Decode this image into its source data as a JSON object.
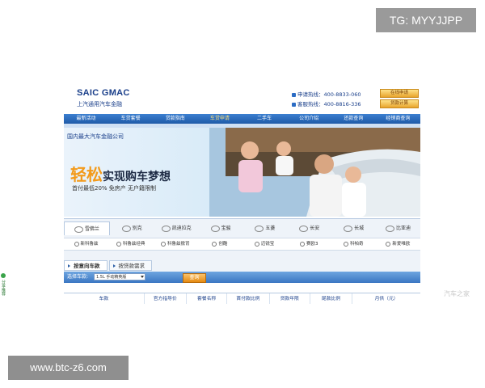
{
  "watermark_top": "TG: MYYJJPP",
  "watermark_bottom": "www.btc-z6.com",
  "header": {
    "logo_en": "SAIC GMAC",
    "logo_cn": "上汽通用汽车金融",
    "hotline_apply_label": "申请热线：",
    "hotline_apply_number": "400-8833-060",
    "hotline_service_label": "客服热线：",
    "hotline_service_number": "400-8816-336",
    "btn_online_apply": "在线申请",
    "btn_loan_calc": "贷款计算"
  },
  "nav": {
    "items": [
      "最新活动",
      "车贷套餐",
      "贷款指南",
      "车贷申请",
      "二手车",
      "公司介绍",
      "还款查询",
      "经销商查询"
    ],
    "active_index": 3
  },
  "banner": {
    "top_text": "国内最大汽车金融公司",
    "slogan_big": "轻松",
    "slogan_rest": "实现购车梦想",
    "subline": "首付最低20%  免房产  无户籍限制"
  },
  "brands": [
    "雪佛兰",
    "别克",
    "凯迪拉克",
    "宝骏",
    "五菱",
    "长安",
    "长城",
    "比亚迪"
  ],
  "models": [
    "新科鲁兹",
    "科鲁兹经典",
    "科鲁兹掀背",
    "创酷",
    "迈锐宝",
    "赛欧3",
    "科帕奇",
    "新爱唯欧"
  ],
  "tabs": [
    "按意向车款",
    "按贷款需求"
  ],
  "search": {
    "label": "选择车款:",
    "selected": "1.5L 手动精英版",
    "button": "查询"
  },
  "table_headers": [
    "车款",
    "官方指导价",
    "套餐名称",
    "首付款比例",
    "贷款年限",
    "尾款比例",
    "月供（元）"
  ],
  "side_badge": "分享推荐",
  "corner_mark": "汽车之家"
}
